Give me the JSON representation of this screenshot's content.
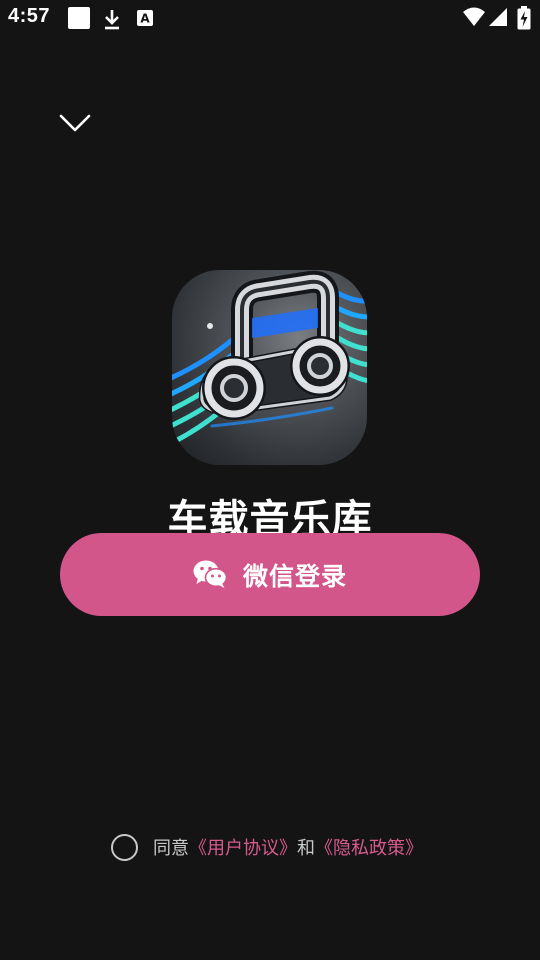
{
  "status_bar": {
    "time": "4:57",
    "icons": [
      "notification-square-icon",
      "download-icon",
      "keyboard-a-icon",
      "wifi-icon",
      "signal-icon",
      "battery-charging-icon"
    ]
  },
  "header": {
    "collapse_icon": "chevron-down-icon"
  },
  "app": {
    "name": "车载音乐库",
    "logo_icon": "music-note-car-logo"
  },
  "login": {
    "button_label": "微信登录",
    "icon": "wechat-icon"
  },
  "agreement": {
    "prefix": "同意",
    "user_agreement": "《用户协议》",
    "conjunction": "和",
    "privacy_policy": "《隐私政策》"
  },
  "colors": {
    "background": "#141414",
    "accent": "#d2568a",
    "link": "#d85a8e",
    "logo_cyan": "#3fe0d0",
    "logo_blue": "#1e90ff"
  }
}
